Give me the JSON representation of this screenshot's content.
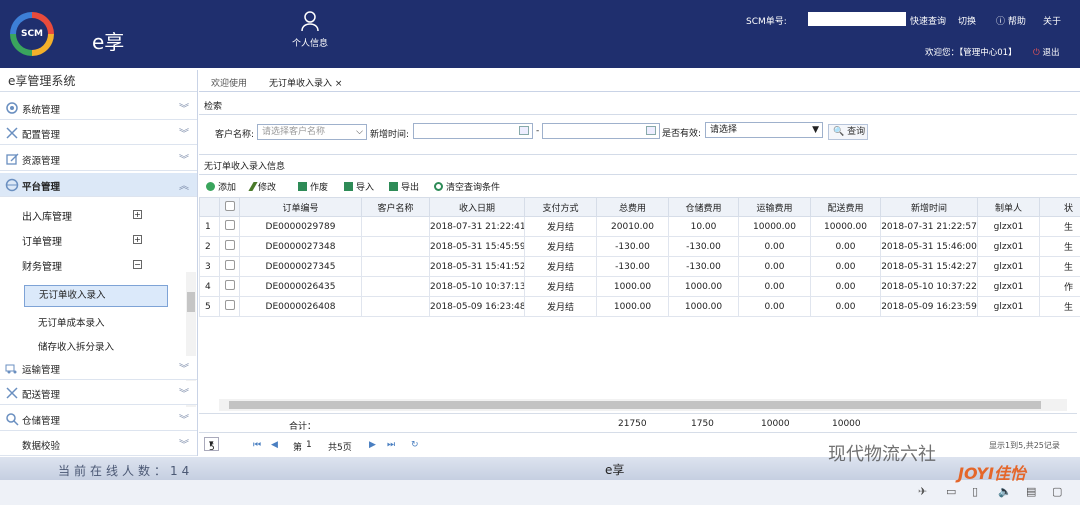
{
  "header": {
    "logo_text": "SCM",
    "app_name": "e享",
    "user_info": "个人信息",
    "scm_label": "SCM单号:",
    "quick_search": "快速查询",
    "switch": "切换",
    "help": "帮助",
    "about": "关于",
    "welcome": "欢迎您：【管理中心01】",
    "logout": "退出"
  },
  "sidebar": {
    "title": "e享管理系统",
    "menus": [
      "系统管理",
      "配置管理",
      "资源管理",
      "平台管理",
      "运输管理",
      "配送管理",
      "仓储管理",
      "数据校验"
    ],
    "sub": [
      "出入库管理",
      "订单管理",
      "财务管理"
    ],
    "leaves": [
      "无订单收入录入",
      "无订单成本录入",
      "储存收入拆分录入"
    ]
  },
  "tabs": {
    "welcome": "欢迎使用",
    "current": "无订单收入录入",
    "close": "×"
  },
  "search": {
    "section": "检索",
    "customer_label": "客户名称:",
    "customer_placeholder": "请选择客户名称",
    "time_label": "新增时间:",
    "dash": "-",
    "valid_label": "是否有效:",
    "valid_value": "请选择",
    "button": "查询"
  },
  "grid": {
    "section": "无订单收入录入信息",
    "toolbar": [
      "添加",
      "修改",
      "作废",
      "导入",
      "导出",
      "清空查询条件"
    ],
    "headers": [
      "",
      "",
      "订单编号",
      "客户名称",
      "收入日期",
      "支付方式",
      "总费用",
      "仓储费用",
      "运输费用",
      "配送费用",
      "新增时间",
      "制单人",
      "状"
    ],
    "rows": [
      [
        "1",
        "DE0000029789",
        "",
        "2018-07-31 21:22:41",
        "发月结",
        "20010.00",
        "10.00",
        "10000.00",
        "10000.00",
        "2018-07-31 21:22:57",
        "glzx01",
        "生"
      ],
      [
        "2",
        "DE0000027348",
        "",
        "2018-05-31 15:45:59",
        "发月结",
        "-130.00",
        "-130.00",
        "0.00",
        "0.00",
        "2018-05-31 15:46:00",
        "glzx01",
        "生"
      ],
      [
        "3",
        "DE0000027345",
        "",
        "2018-05-31 15:41:52",
        "发月结",
        "-130.00",
        "-130.00",
        "0.00",
        "0.00",
        "2018-05-31 15:42:27",
        "glzx01",
        "生"
      ],
      [
        "4",
        "DE0000026435",
        "",
        "2018-05-10 10:37:13",
        "发月结",
        "1000.00",
        "1000.00",
        "0.00",
        "0.00",
        "2018-05-10 10:37:22",
        "glzx01",
        "作"
      ],
      [
        "5",
        "DE0000026408",
        "",
        "2018-05-09 16:23:48",
        "发月结",
        "1000.00",
        "1000.00",
        "0.00",
        "0.00",
        "2018-05-09 16:23:59",
        "glzx01",
        "生"
      ]
    ],
    "total_label": "合计：",
    "totals": [
      "21750",
      "1750",
      "10000",
      "10000"
    ]
  },
  "pager": {
    "size": "5",
    "page_pre": "第",
    "page_cur": "1",
    "page_post": "共5页",
    "info": "显示1到5,共25记录"
  },
  "footer": {
    "online": "当前在线人数：14",
    "title": "e享"
  },
  "watermark": {
    "text": "现代物流六社",
    "brand": "JOYI佳怡"
  }
}
